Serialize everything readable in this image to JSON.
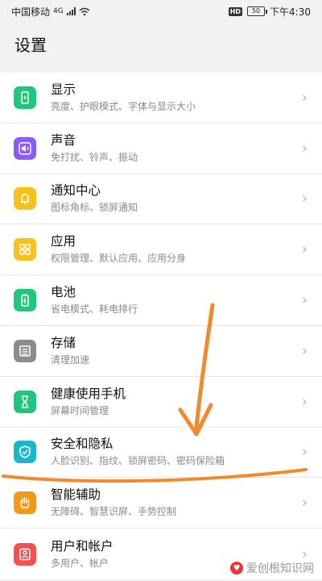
{
  "status_bar": {
    "carrier": "中国移动",
    "network": "4G",
    "hd": "HD",
    "battery": "50",
    "time": "下午4:30"
  },
  "page": {
    "title": "设置"
  },
  "settings": [
    {
      "title": "显示",
      "subtitle": "亮度、护眼模式、字体与显示大小",
      "color": "#1fc77a",
      "icon": "display-icon"
    },
    {
      "title": "声音",
      "subtitle": "免打扰、铃声、振动",
      "color": "#8a5cf6",
      "icon": "sound-icon"
    },
    {
      "title": "通知中心",
      "subtitle": "图标角标、锁屏通知",
      "color": "#f7c21d",
      "icon": "bell-icon"
    },
    {
      "title": "应用",
      "subtitle": "权限管理、默认应用、应用分身",
      "color": "#f7c21d",
      "icon": "apps-icon"
    },
    {
      "title": "电池",
      "subtitle": "省电模式、耗电排行",
      "color": "#1fc77a",
      "icon": "battery-icon"
    },
    {
      "title": "存储",
      "subtitle": "清理加速",
      "color": "#8c8c8c",
      "icon": "storage-icon"
    },
    {
      "title": "健康使用手机",
      "subtitle": "屏幕时间管理",
      "color": "#1fc77a",
      "icon": "hourglass-icon"
    },
    {
      "title": "安全和隐私",
      "subtitle": "人脸识别、指纹、锁屏密码、密码保险箱",
      "color": "#17b8c9",
      "icon": "shield-icon"
    },
    {
      "title": "智能辅助",
      "subtitle": "无障碍、智慧识屏、手势控制",
      "color": "#f39a1e",
      "icon": "hand-icon"
    },
    {
      "title": "用户和帐户",
      "subtitle": "多用户、帐户",
      "color": "#f0534f",
      "icon": "user-icon"
    }
  ],
  "watermark": {
    "text": "爱创根知识网"
  },
  "annotation_color": "#f08a2c"
}
